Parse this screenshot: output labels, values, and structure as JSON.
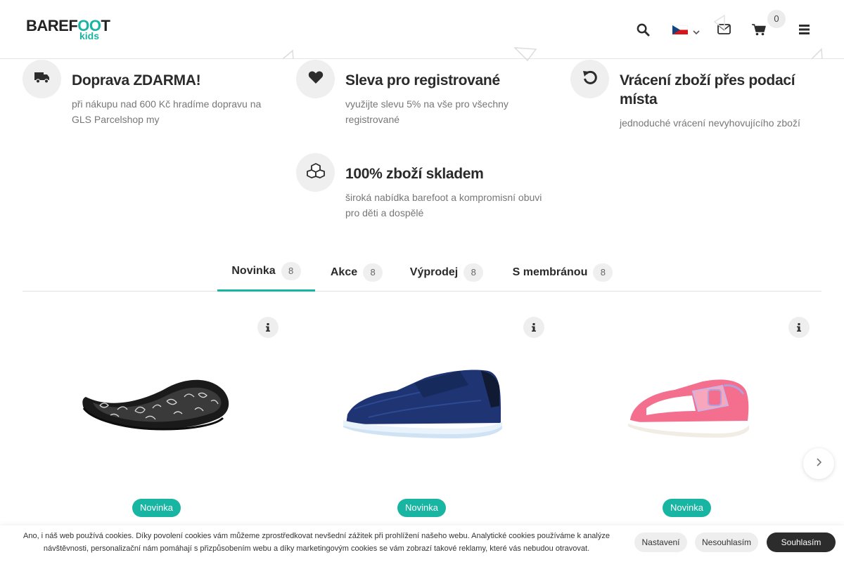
{
  "header": {
    "logo_main": "BAREF",
    "logo_oo": "OO",
    "logo_end": "T",
    "logo_sub": "kids",
    "cart_count": "0",
    "icons": [
      "search-icon",
      "flag-cz-icon",
      "chevron-down-icon",
      "envelope-icon",
      "cart-icon",
      "menu-icon"
    ]
  },
  "features": [
    {
      "icon": "truck-icon",
      "title": "Doprava ZDARMA!",
      "desc_line1": "při nákupu nad 600 Kč hradíme dopravu na",
      "desc_line2": "GLS Parcelshop my"
    },
    {
      "icon": "heart-icon",
      "title": "Sleva pro registrované",
      "desc_line1": "využijte slevu 5% na vše pro všechny",
      "desc_line2": "registrované"
    },
    {
      "icon": "undo-icon",
      "title_line1": "Vrácení zboží přes podací",
      "title_line2": "místa",
      "desc_line1": "jednoduché vrácení nevyhovujícího zboží"
    },
    {
      "icon": "cubes-icon",
      "title": "100% zboží skladem",
      "desc_line1": "široká nabídka barefoot a kompromisní obuvi",
      "desc_line2": "pro děti a dospělé"
    }
  ],
  "tabs": [
    {
      "label": "Novinka",
      "count": "8",
      "active": true
    },
    {
      "label": "Akce",
      "count": "8",
      "active": false
    },
    {
      "label": "Výprodej",
      "count": "8",
      "active": false
    },
    {
      "label": "S membránou",
      "count": "8",
      "active": false
    }
  ],
  "products": [
    {
      "badge": "Novinka",
      "image": "black-patterned-ballet-flat"
    },
    {
      "badge": "Novinka",
      "image": "navy-sneaker"
    },
    {
      "badge": "Novinka",
      "image": "pink-sandal"
    }
  ],
  "cookie": {
    "text_line1": "Ano, i náš web používá cookies. Díky povolení cookies vám můžeme zprostředkovat nevšední zážitek při prohlížení našeho webu. Analytické cookies používáme k analýze",
    "text_line2": "návštěvnosti, personalizační nám pomáhají s přizpůsobením webu a díky marketingovým cookies se vám zobrazí takové reklamy, které vás nebudou otravovat.",
    "btn_settings": "Nastavení",
    "btn_decline": "Nesouhlasím",
    "btn_accept": "Souhlasím"
  },
  "colors": {
    "accent": "#19b5a3",
    "dark": "#2c2c2c"
  }
}
